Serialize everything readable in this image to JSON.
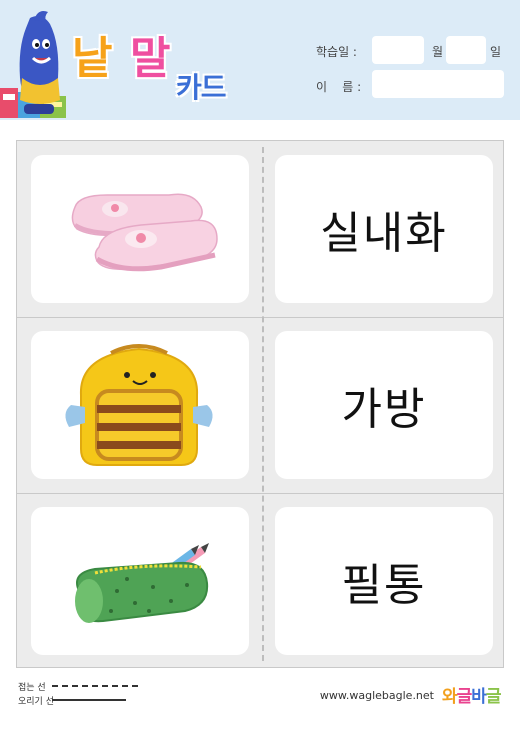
{
  "header": {
    "logo": {
      "word1": "낱",
      "word2": "말",
      "word3": "카드"
    },
    "mascot_name": "mascot",
    "fields": {
      "study_date_label": "학습일 :",
      "month_label": "월",
      "day_label": "일",
      "name_label": "이    름 :"
    }
  },
  "cards": [
    {
      "word": "실내화",
      "image": "pink-indoor-shoes"
    },
    {
      "word": "가방",
      "image": "bee-backpack"
    },
    {
      "word": "필통",
      "image": "green-pencil-case"
    }
  ],
  "footer": {
    "fold_line_label": "접는 선",
    "cut_line_label": "오리기 선",
    "website": "www.waglebagle.net",
    "brand": {
      "c1": "와",
      "c2": "글",
      "c3": "바",
      "c4": "글"
    }
  },
  "colors": {
    "header_bg": "#dcebf7",
    "logo_orange": "#f6a21a",
    "logo_pink": "#ef4fa0",
    "logo_blue": "#3b6fd6",
    "grid_bg": "#ececec"
  }
}
